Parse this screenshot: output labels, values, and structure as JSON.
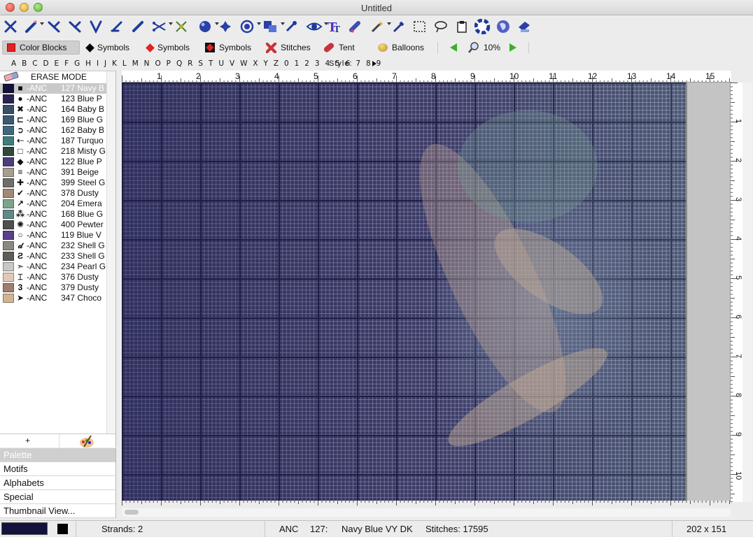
{
  "window": {
    "title": "Untitled"
  },
  "toolbar2": {
    "color_blocks": "Color Blocks",
    "symbols_1": "Symbols",
    "symbols_2": "Symbols",
    "symbols_3": "Symbols",
    "stitches": "Stitches",
    "tent": "Tent",
    "balloons": "Balloons",
    "zoom": "10%"
  },
  "alphabet": {
    "letters": "A B C D E F G H I J K L M N O P Q R S T U V W X Y Z 0 1 2 3 4 5 6 7 8 9",
    "style_label": "Style:"
  },
  "palette": {
    "erase_label": "ERASE MODE",
    "items": [
      {
        "brand": "-ANC",
        "num": "127 Navy B",
        "sym": "■",
        "color": "#14113d"
      },
      {
        "brand": "-ANC",
        "num": "123 Blue P",
        "sym": "●",
        "color": "#2a2452"
      },
      {
        "brand": "-ANC",
        "num": "164 Baby B",
        "sym": "✖",
        "color": "#3a4f68"
      },
      {
        "brand": "-ANC",
        "num": "169 Blue G",
        "sym": "⊏",
        "color": "#3c5a74"
      },
      {
        "brand": "-ANC",
        "num": "162 Baby B",
        "sym": "➲",
        "color": "#3d6b7d"
      },
      {
        "brand": "-ANC",
        "num": "187 Turquo",
        "sym": "⇠",
        "color": "#3f7f7a"
      },
      {
        "brand": "-ANC",
        "num": "218 Misty G",
        "sym": "□",
        "color": "#2f4a3c"
      },
      {
        "brand": "-ANC",
        "num": "122 Blue P",
        "sym": "◆",
        "color": "#4a3f78"
      },
      {
        "brand": "-ANC",
        "num": "391 Beige",
        "sym": "≡",
        "color": "#a69e8e"
      },
      {
        "brand": "-ANC",
        "num": "399 Steel G",
        "sym": "✚",
        "color": "#6e6e6e"
      },
      {
        "brand": "-ANC",
        "num": "378 Dusty",
        "sym": "✔",
        "color": "#a38876"
      },
      {
        "brand": "-ANC",
        "num": "204 Emera",
        "sym": "↗",
        "color": "#7fa48a"
      },
      {
        "brand": "-ANC",
        "num": "168 Blue G",
        "sym": "⁂",
        "color": "#5f8a8a"
      },
      {
        "brand": "-ANC",
        "num": "400 Pewter",
        "sym": "✺",
        "color": "#4f4f4f"
      },
      {
        "brand": "-ANC",
        "num": "119 Blue V",
        "sym": "○",
        "color": "#5a3f8a"
      },
      {
        "brand": "-ANC",
        "num": "232 Shell G",
        "sym": "𝒹",
        "color": "#8a8880"
      },
      {
        "brand": "-ANC",
        "num": "233 Shell G",
        "sym": "Ƨ",
        "color": "#5f5d58"
      },
      {
        "brand": "-ANC",
        "num": "234 Pearl G",
        "sym": "➣",
        "color": "#c8c8c6"
      },
      {
        "brand": "-ANC",
        "num": "376 Dusty",
        "sym": "⌶",
        "color": "#e2c8b8"
      },
      {
        "brand": "-ANC",
        "num": "379 Dusty",
        "sym": "3",
        "color": "#9c7f70"
      },
      {
        "brand": "-ANC",
        "num": "347 Choco",
        "sym": "➤",
        "color": "#d2b494"
      }
    ],
    "add_label": "+"
  },
  "sections": [
    "Palette",
    "Motifs",
    "Alphabets",
    "Special",
    "Thumbnail View..."
  ],
  "rulers": {
    "h": [
      "1",
      "2",
      "3",
      "4",
      "5",
      "6",
      "7",
      "8",
      "9",
      "10",
      "11",
      "12",
      "13",
      "14",
      "15"
    ],
    "v": [
      "1",
      "2",
      "3",
      "4",
      "5",
      "6",
      "7",
      "8",
      "9",
      "10"
    ]
  },
  "status": {
    "strands": "Strands:  2",
    "brand": "ANC",
    "num": "127:",
    "name": "Navy Blue VY DK",
    "stitches": "Stitches: 17595",
    "size": "202 x 151"
  },
  "colors": {
    "selected_thread": "#14113d",
    "grid_bg": "#3a3a62"
  }
}
